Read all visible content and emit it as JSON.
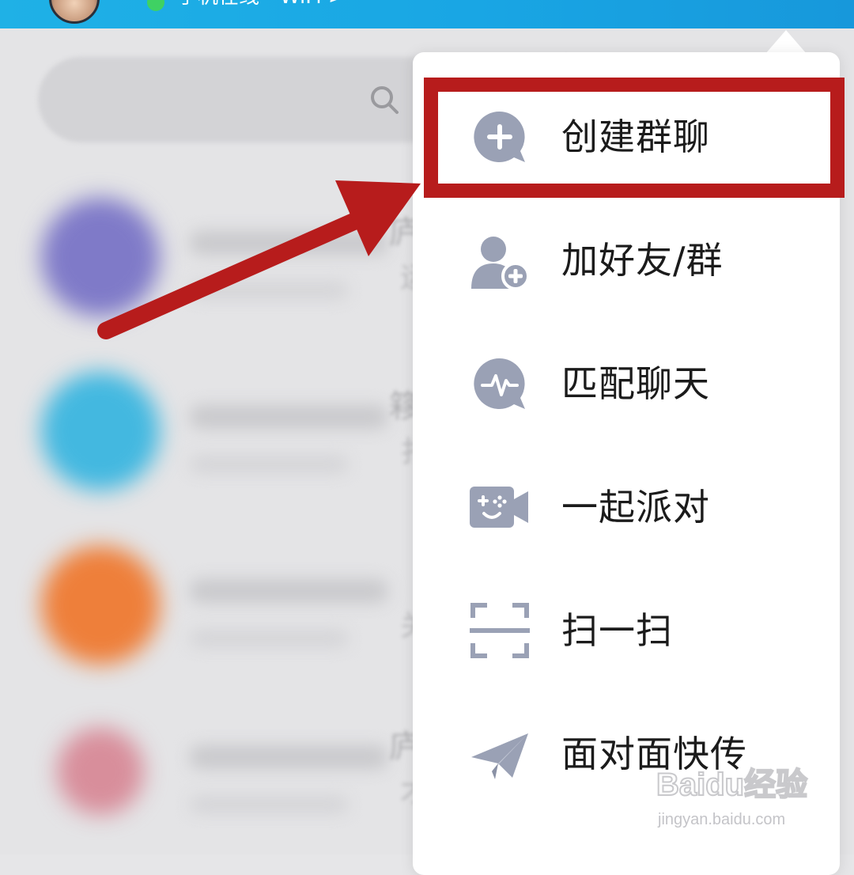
{
  "status_bar": {
    "status_text": "手机在线 - WiFi >"
  },
  "search": {
    "icon": "search-icon"
  },
  "contacts_background": [
    {
      "avatar_color": "#7f7ac8",
      "peek": "庐",
      "peek2": "运"
    },
    {
      "avatar_color": "#43b8e0",
      "peek": "簃",
      "peek2": "扌"
    },
    {
      "avatar_color": "#ee7f3a",
      "peek": "",
      "peek2": "关"
    },
    {
      "avatar_color": "#d88e9b",
      "peek": "庐",
      "peek2": "才"
    }
  ],
  "menu": {
    "items": [
      {
        "label": "创建群聊",
        "icon": "create-group-chat-icon"
      },
      {
        "label": "加好友/群",
        "icon": "add-friend-icon"
      },
      {
        "label": "匹配聊天",
        "icon": "match-chat-icon"
      },
      {
        "label": "一起派对",
        "icon": "party-game-icon"
      },
      {
        "label": "扫一扫",
        "icon": "scan-icon"
      },
      {
        "label": "面对面快传",
        "icon": "paper-plane-icon"
      }
    ]
  },
  "annotation": {
    "highlight_color": "#b71c1c",
    "arrow_color": "#b71c1c"
  },
  "colors": {
    "topbar": "#19a6e4",
    "icon_gray": "#9aa1b5",
    "online_green": "#3fd163"
  },
  "watermark": {
    "brand": "Baidu经验",
    "url": "jingyan.baidu.com"
  }
}
